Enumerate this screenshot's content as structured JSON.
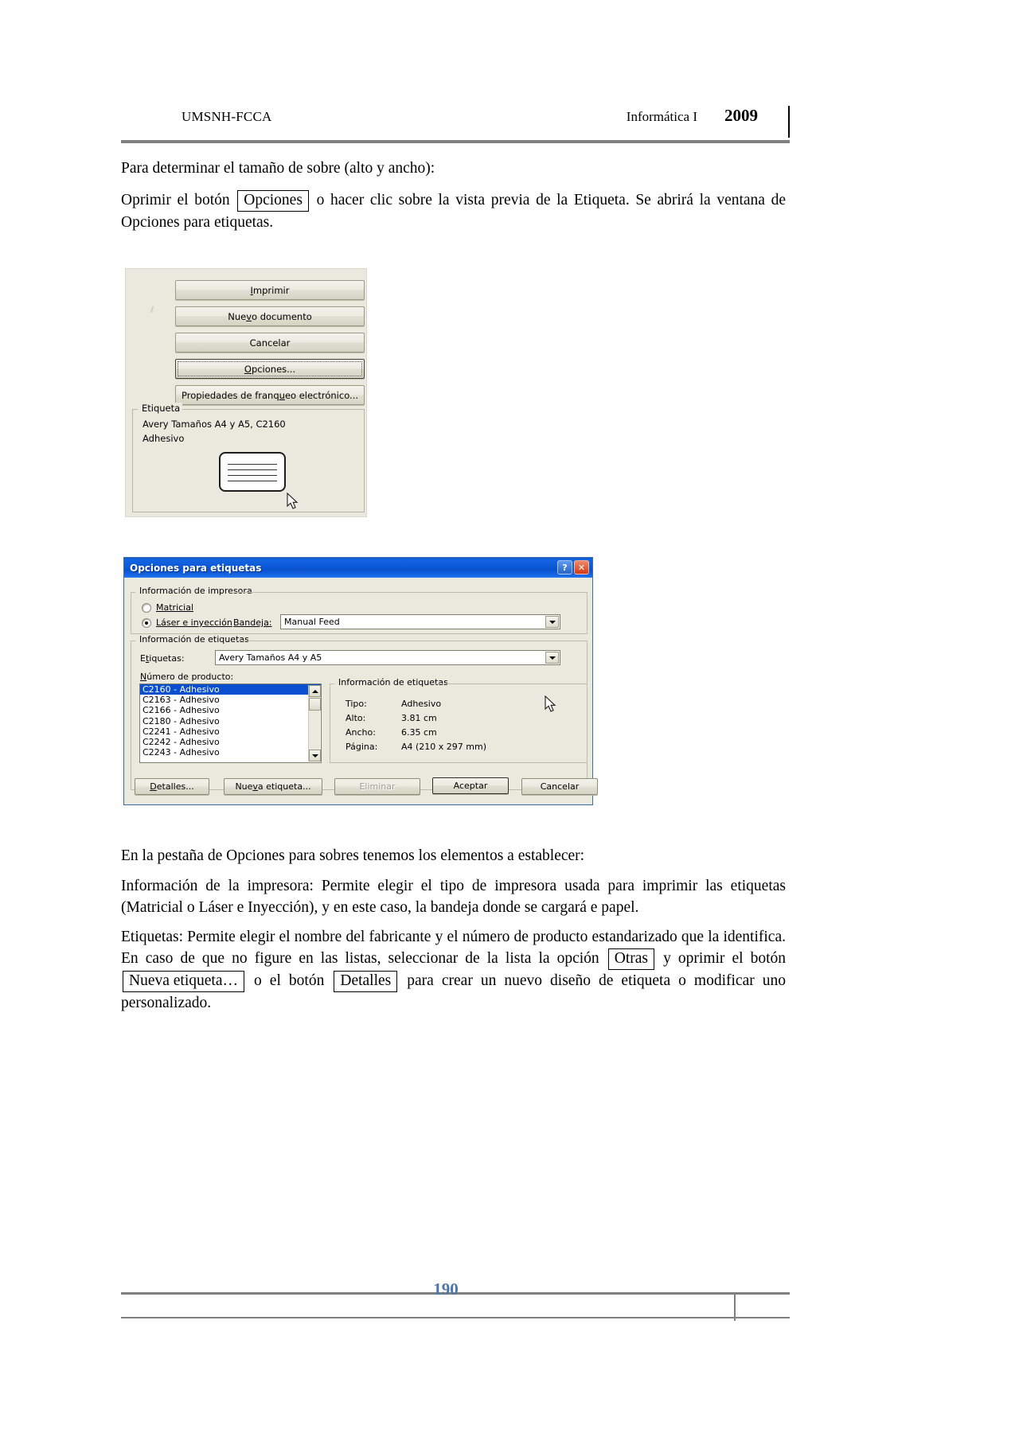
{
  "header": {
    "left": "UMSNH-FCCA",
    "right": "Informática I",
    "year": "2009"
  },
  "body": {
    "p1": "Para determinar el tamaño de sobre (alto y ancho):",
    "p2_before": "Oprimir el botón",
    "p2_button": "Opciones",
    "p2_after": "o hacer clic sobre la vista previa de la Etiqueta. Se abrirá la ventana de Opciones para etiquetas.",
    "p3": "En la pestaña de Opciones para sobres tenemos los elementos a establecer:",
    "p4": "Información de la impresora: Permite elegir el tipo de impresora usada para imprimir las etiquetas (Matricial o Láser e Inyección), y en este caso, la bandeja donde se cargará e papel.",
    "p5_a": "Etiquetas: Permite elegir el nombre del fabricante y el número de producto estandarizado que la identifica. En caso de que no figure en las listas, seleccionar de la lista la opción",
    "p5_btn1": "Otras",
    "p5_b": "y oprimir el botón",
    "p5_btn2": "Nueva etiqueta…",
    "p5_c": "o el botón",
    "p5_btn3": "Detalles",
    "p5_d": "para crear un nuevo diseño de etiqueta o modificar uno personalizado."
  },
  "print_panel": {
    "buttons": [
      {
        "pre": "",
        "acc": "I",
        "post": "mprimir"
      },
      {
        "pre": "Nue",
        "acc": "v",
        "post": "o documento"
      },
      {
        "pre": "Cancelar",
        "acc": "",
        "post": ""
      },
      {
        "pre": "",
        "acc": "O",
        "post": "pciones..."
      },
      {
        "pre": "Propiedades de franq",
        "acc": "u",
        "post": "eo electrónico..."
      }
    ],
    "group_title": "Etiqueta",
    "line1": "Avery Tamaños A4 y A5, C2160",
    "line2": "Adhesivo"
  },
  "dialog": {
    "title": "Opciones para etiquetas",
    "help_glyph": "?",
    "close_glyph": "✕",
    "printer_group": "Información de impresora",
    "radio_matricial": "Matricial",
    "radio_matricial_checked": false,
    "radio_laser": "Láser e inyección",
    "radio_laser_checked": true,
    "tray_label": "Bandeja:",
    "tray_value": "Manual Feed",
    "labels_group": "Información de etiquetas",
    "labels_label": "Etiquetas:",
    "labels_value": "Avery Tamaños A4 y A5",
    "product_label": "Número de producto:",
    "products": [
      "C2160 - Adhesivo",
      "C2163 - Adhesivo",
      "C2166 - Adhesivo",
      "C2180 - Adhesivo",
      "C2241 - Adhesivo",
      "C2242 - Adhesivo",
      "C2243 - Adhesivo"
    ],
    "selected_product_index": 0,
    "info_group": "Información de etiquetas",
    "info": [
      {
        "key": "Tipo:",
        "value": "Adhesivo"
      },
      {
        "key": "Alto:",
        "value": "3.81 cm"
      },
      {
        "key": "Ancho:",
        "value": "6.35 cm"
      },
      {
        "key": "Página:",
        "value": "A4 (210 x 297 mm)"
      }
    ],
    "buttons": {
      "detalles": "Detalles...",
      "nueva": "Nueva etiqueta...",
      "eliminar": "Eliminar",
      "aceptar": "Aceptar",
      "cancelar": "Cancelar"
    }
  },
  "footer": {
    "page": "190"
  },
  "colors": {
    "title_blue": "#0d59d8",
    "selection_blue": "#0a4fcf",
    "page_number": "#4a76a8",
    "dialog_face": "#e9e9de",
    "rule_gray": "#808080"
  }
}
